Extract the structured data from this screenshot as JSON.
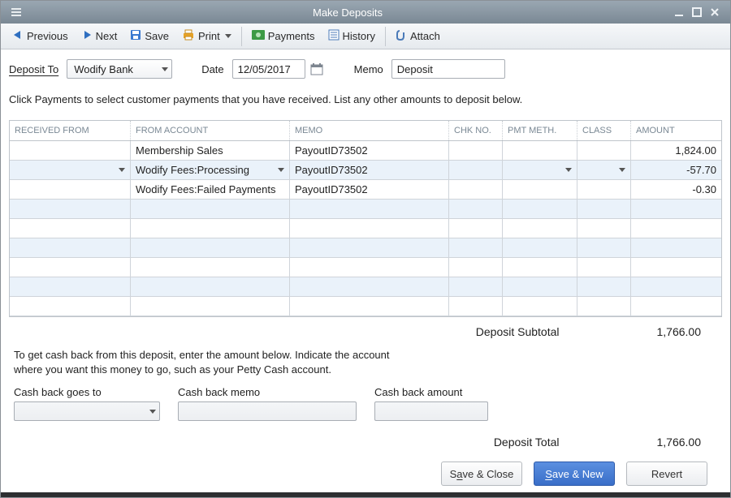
{
  "window": {
    "title": "Make Deposits"
  },
  "toolbar": {
    "previous": "Previous",
    "next": "Next",
    "save": "Save",
    "print": "Print",
    "payments": "Payments",
    "history": "History",
    "attach": "Attach"
  },
  "form": {
    "deposit_to_label": "Deposit To",
    "deposit_to_value": "Wodify Bank",
    "date_label": "Date",
    "date_value": "12/05/2017",
    "memo_label": "Memo",
    "memo_value": "Deposit"
  },
  "instruction": "Click Payments to select customer payments that you have received. List any other amounts to deposit below.",
  "grid": {
    "headers": {
      "received_from": "RECEIVED FROM",
      "from_account": "FROM ACCOUNT",
      "memo": "MEMO",
      "chk_no": "CHK NO.",
      "pmt_meth": "PMT METH.",
      "class": "CLASS",
      "amount": "AMOUNT"
    },
    "rows": [
      {
        "received_from": "",
        "from_account": "Membership Sales",
        "memo": "PayoutID73502",
        "chk": "",
        "pmt": "",
        "cls": "",
        "amount": "1,824.00"
      },
      {
        "received_from": "",
        "from_account": "Wodify Fees:Processing",
        "memo": "PayoutID73502",
        "chk": "",
        "pmt": "",
        "cls": "",
        "amount": "-57.70",
        "active": true
      },
      {
        "received_from": "",
        "from_account": "Wodify Fees:Failed Payments",
        "memo": "PayoutID73502",
        "chk": "",
        "pmt": "",
        "cls": "",
        "amount": "-0.30"
      }
    ]
  },
  "subtotals": {
    "subtotal_label": "Deposit Subtotal",
    "subtotal_value": "1,766.00",
    "total_label": "Deposit Total",
    "total_value": "1,766.00"
  },
  "cashback": {
    "hint_line1": "To get cash back from this deposit, enter the amount below.  Indicate the account",
    "hint_line2": "where you want this money to go, such as your Petty Cash account.",
    "goes_to_label": "Cash back goes to",
    "memo_label": "Cash back memo",
    "amount_label": "Cash back amount"
  },
  "buttons": {
    "save_close_pre": "S",
    "save_close_u": "a",
    "save_close_post": "ve & Close",
    "save_new_u": "S",
    "save_new_post": "ave & New",
    "revert": "Revert"
  }
}
